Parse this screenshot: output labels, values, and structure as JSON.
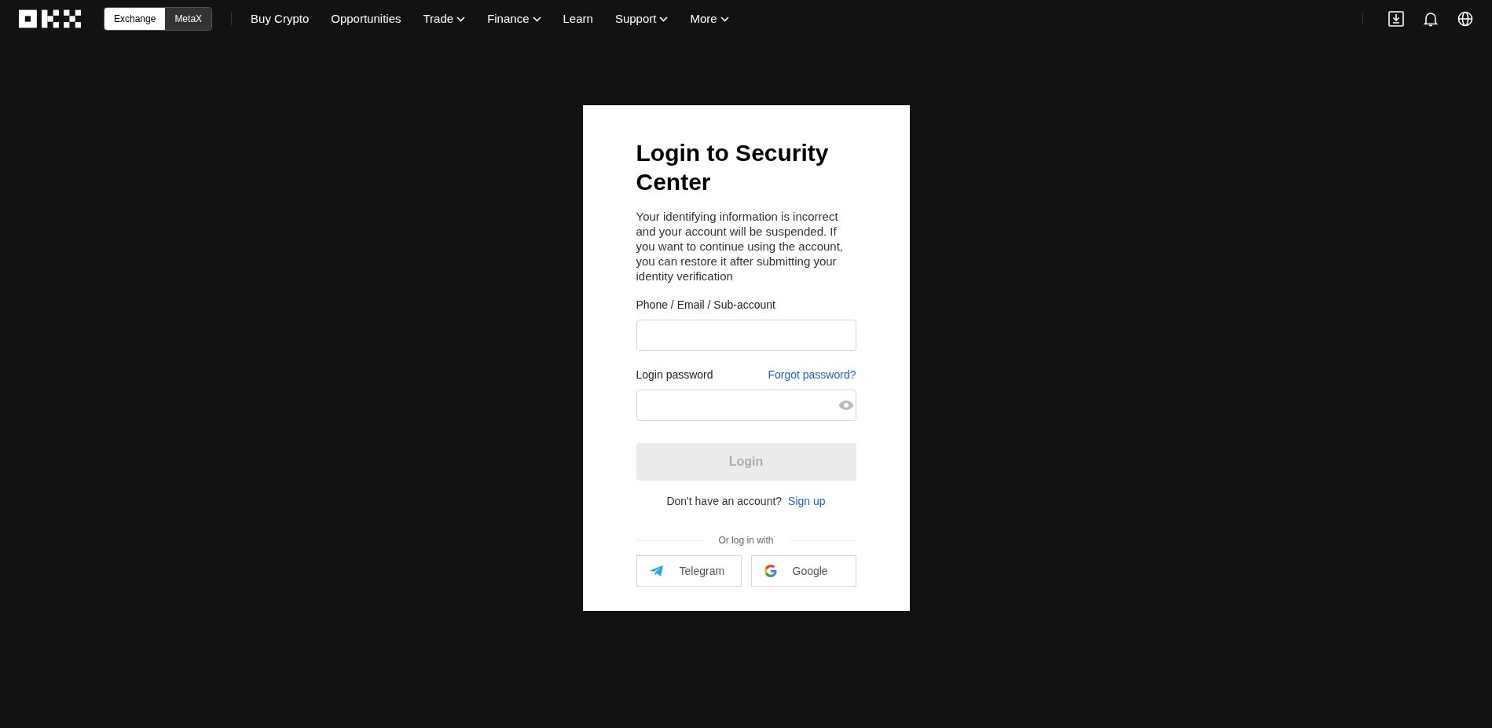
{
  "header": {
    "platform_switch": [
      {
        "label": "Exchange",
        "selected": true
      },
      {
        "label": "MetaX",
        "selected": false
      }
    ],
    "nav": [
      {
        "label": "Buy Crypto",
        "has_menu": false
      },
      {
        "label": "Opportunities",
        "has_menu": false
      },
      {
        "label": "Trade",
        "has_menu": true
      },
      {
        "label": "Finance",
        "has_menu": true
      },
      {
        "label": "Learn",
        "has_menu": false
      },
      {
        "label": "Support",
        "has_menu": true
      },
      {
        "label": "More",
        "has_menu": true
      }
    ]
  },
  "login_card": {
    "title": "Login to Security Center",
    "message": "Your identifying information is incorrect and your account will be suspended. If you want to continue using the account, you can restore it after submitting your identity verification",
    "account_field": {
      "label": "Phone / Email / Sub-account"
    },
    "password_field": {
      "label": "Login password",
      "forgot_link": "Forgot password?"
    },
    "login_button": {
      "label": "Login",
      "disabled": true
    },
    "signup_prompt": "Don't have an account?",
    "signup_link": "Sign up",
    "divider_text": "Or log in with",
    "social_buttons": [
      {
        "kind": "telegram",
        "label": "Telegram"
      },
      {
        "kind": "google",
        "label": "Google"
      }
    ]
  }
}
